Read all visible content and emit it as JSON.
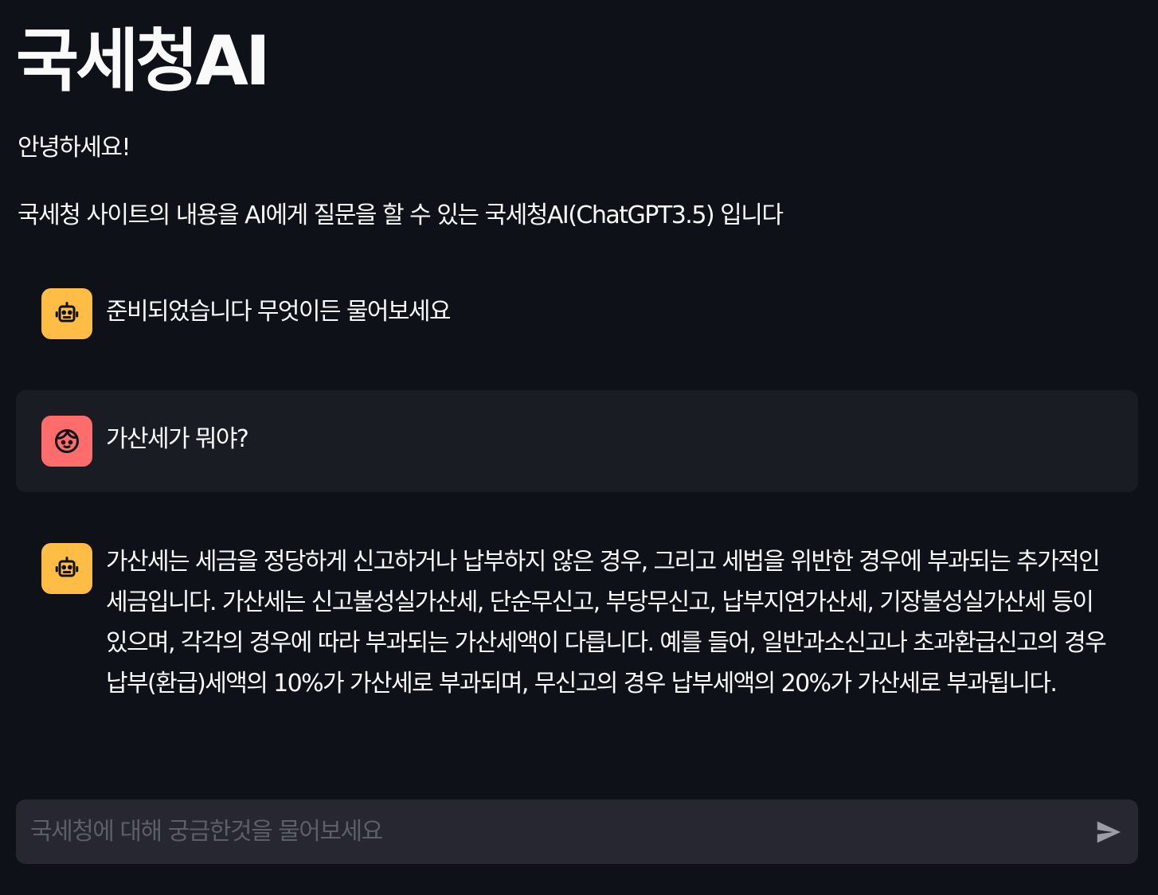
{
  "app": {
    "title": "국세청AI",
    "greeting": "안녕하세요!",
    "description": "국세청 사이트의 내용을 AI에게 질문을 할 수 있는 국세청AI(ChatGPT3.5) 입니다"
  },
  "messages": [
    {
      "role": "assistant",
      "avatar_icon": "robot-face-icon",
      "text": "준비되었습니다 무엇이든 물어보세요"
    },
    {
      "role": "user",
      "avatar_icon": "user-face-icon",
      "text": "가산세가 뭐야?"
    },
    {
      "role": "assistant",
      "avatar_icon": "robot-face-icon",
      "text": "가산세는 세금을 정당하게 신고하거나 납부하지 않은 경우, 그리고 세법을 위반한 경우에 부과되는 추가적인 세금입니다. 가산세는 신고불성실가산세, 단순무신고, 부당무신고, 납부지연가산세, 기장불성실가산세 등이 있으며, 각각의 경우에 따라 부과되는 가산세액이 다릅니다. 예를 들어, 일반과소신고나 초과환급신고의 경우 납부(환급)세액의 10%가 가산세로 부과되며, 무신고의 경우 납부세액의 20%가 가산세로 부과됩니다."
    }
  ],
  "chat_input": {
    "value": "",
    "placeholder": "국세청에 대해 궁금한것을 물어보세요",
    "send_icon": "send-icon"
  },
  "colors": {
    "background": "#0e1117",
    "user_message_bg": "#1a1c24",
    "assistant_avatar": "#ffbd45",
    "user_avatar": "#ff6c6c",
    "input_bg": "#262730",
    "text": "#fafafa"
  }
}
